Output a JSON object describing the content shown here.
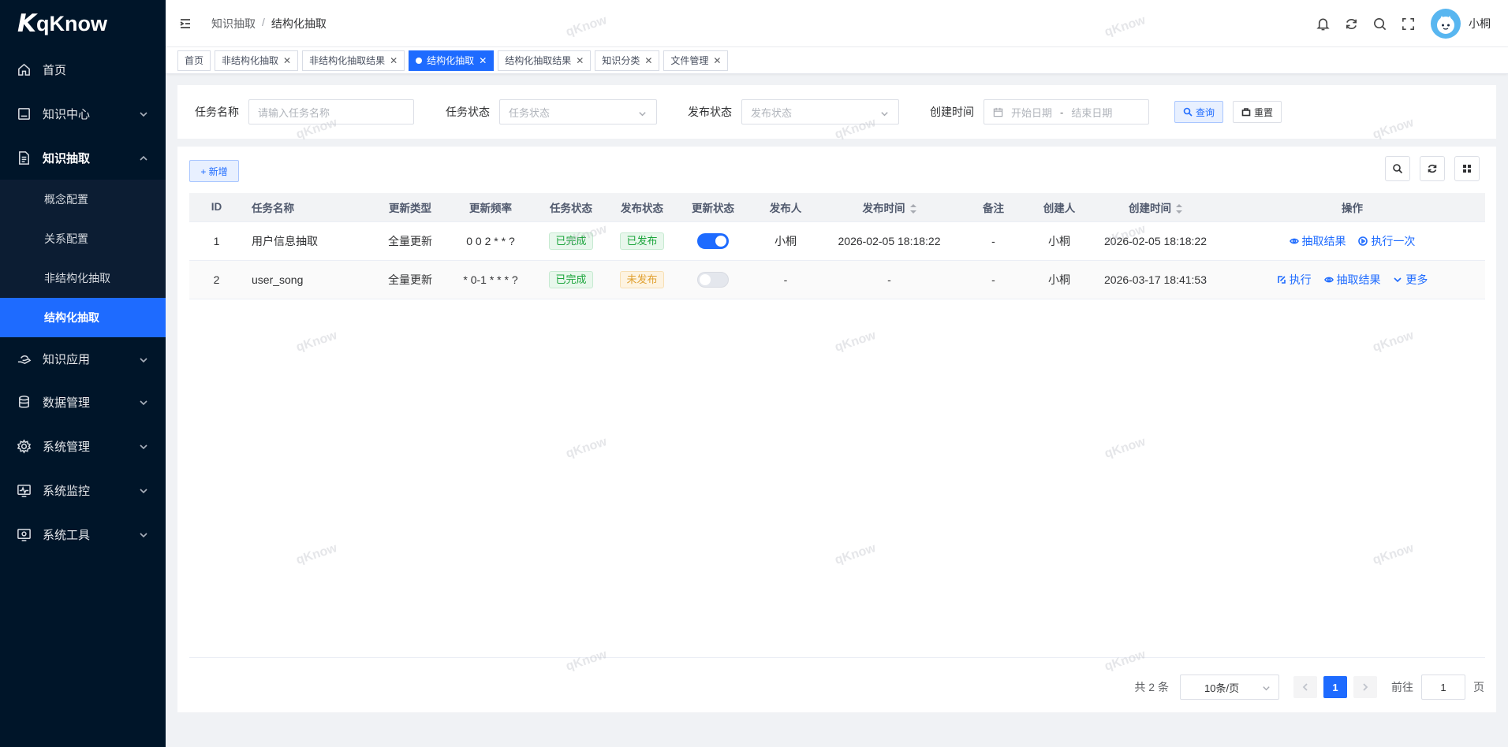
{
  "app": {
    "logo_mark": "K",
    "logo_text": "qKnow",
    "watermark": "qKnow"
  },
  "sidebar": {
    "items": [
      {
        "label": "首页",
        "icon": "home-icon"
      },
      {
        "label": "知识中心",
        "icon": "monitor-icon",
        "expandable": true
      },
      {
        "label": "知识抽取",
        "icon": "document-icon",
        "expandable": true,
        "open": true,
        "children": [
          {
            "label": "概念配置"
          },
          {
            "label": "关系配置"
          },
          {
            "label": "非结构化抽取"
          },
          {
            "label": "结构化抽取",
            "active": true
          }
        ]
      },
      {
        "label": "知识应用",
        "icon": "hand-icon",
        "expandable": true
      },
      {
        "label": "数据管理",
        "icon": "database-icon",
        "expandable": true
      },
      {
        "label": "系统管理",
        "icon": "gear-icon",
        "expandable": true
      },
      {
        "label": "系统监控",
        "icon": "monitor-pulse-icon",
        "expandable": true
      },
      {
        "label": "系统工具",
        "icon": "tools-icon",
        "expandable": true
      }
    ]
  },
  "header": {
    "breadcrumb": [
      "知识抽取",
      "结构化抽取"
    ],
    "username": "小桐",
    "icons": [
      "bell-icon",
      "refresh-icon",
      "search-icon",
      "fullscreen-icon"
    ]
  },
  "tags": [
    {
      "label": "首页",
      "closable": false
    },
    {
      "label": "非结构化抽取",
      "closable": true
    },
    {
      "label": "非结构化抽取结果",
      "closable": true
    },
    {
      "label": "结构化抽取",
      "closable": true,
      "active": true
    },
    {
      "label": "结构化抽取结果",
      "closable": true
    },
    {
      "label": "知识分类",
      "closable": true
    },
    {
      "label": "文件管理",
      "closable": true
    }
  ],
  "search": {
    "task_name_label": "任务名称",
    "task_name_placeholder": "请输入任务名称",
    "task_status_label": "任务状态",
    "task_status_placeholder": "任务状态",
    "publish_status_label": "发布状态",
    "publish_status_placeholder": "发布状态",
    "create_time_label": "创建时间",
    "start_placeholder": "开始日期",
    "range_sep": "-",
    "end_placeholder": "结束日期",
    "query_label": "查询",
    "reset_label": "重置"
  },
  "toolbar": {
    "add_label": "+ 新增"
  },
  "table": {
    "columns": [
      "ID",
      "任务名称",
      "更新类型",
      "更新频率",
      "任务状态",
      "发布状态",
      "更新状态",
      "发布人",
      "发布时间",
      "备注",
      "创建人",
      "创建时间",
      "操作"
    ],
    "rows": [
      {
        "id": "1",
        "name": "用户信息抽取",
        "update_type": "全量更新",
        "frequency": "0 0 2 * * ?",
        "task_status": "已完成",
        "publish_status": "已发布",
        "update_on": true,
        "publisher": "小桐",
        "publish_time": "2026-02-05 18:18:22",
        "remark": "-",
        "creator": "小桐",
        "create_time": "2026-02-05 18:18:22",
        "ops": [
          {
            "label": "抽取结果",
            "icon": "eye-icon"
          },
          {
            "label": "执行一次",
            "icon": "play-circle-icon"
          }
        ]
      },
      {
        "id": "2",
        "name": "user_song",
        "update_type": "全量更新",
        "frequency": "* 0-1 * * * ?",
        "task_status": "已完成",
        "publish_status": "未发布",
        "update_on": false,
        "publisher": "-",
        "publish_time": "-",
        "remark": "-",
        "creator": "小桐",
        "create_time": "2026-03-17 18:41:53",
        "ops": [
          {
            "label": "执行",
            "icon": "edit-icon"
          },
          {
            "label": "抽取结果",
            "icon": "eye-icon"
          },
          {
            "label": "更多",
            "icon": "chevron-down-icon"
          }
        ]
      }
    ]
  },
  "pagination": {
    "total_text": "共 2 条",
    "page_size": "10条/页",
    "current_page": "1",
    "goto_label": "前往",
    "goto_value": "1",
    "page_suffix": "页"
  },
  "colors": {
    "sidebar_bg": "#001529",
    "accent": "#1e6bff",
    "success": "#1aa43a",
    "warning": "#e0a030"
  }
}
